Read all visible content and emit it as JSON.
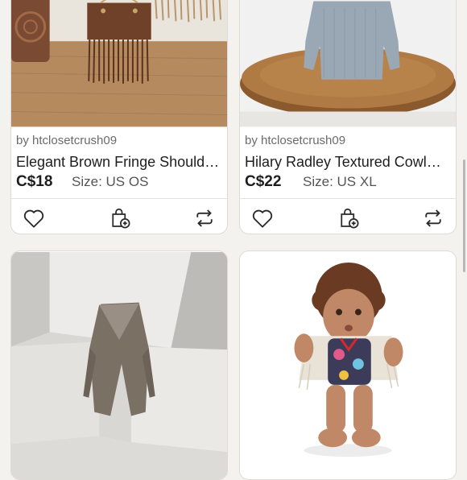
{
  "listings": [
    {
      "seller": "by htclosetcrush09",
      "title": "Elegant Brown Fringe Should…",
      "price": "C$18",
      "size": "Size: US OS"
    },
    {
      "seller": "by htclosetcrush09",
      "title": "Hilary Radley Textured Cowl…",
      "price": "C$22",
      "size": "Size: US XL"
    }
  ],
  "icons": {
    "like": "heart-icon",
    "bundle": "bag-add-icon",
    "share": "share-icon"
  },
  "colors": {
    "background": "#f4f2ef",
    "icon": "#2a2a2a"
  }
}
